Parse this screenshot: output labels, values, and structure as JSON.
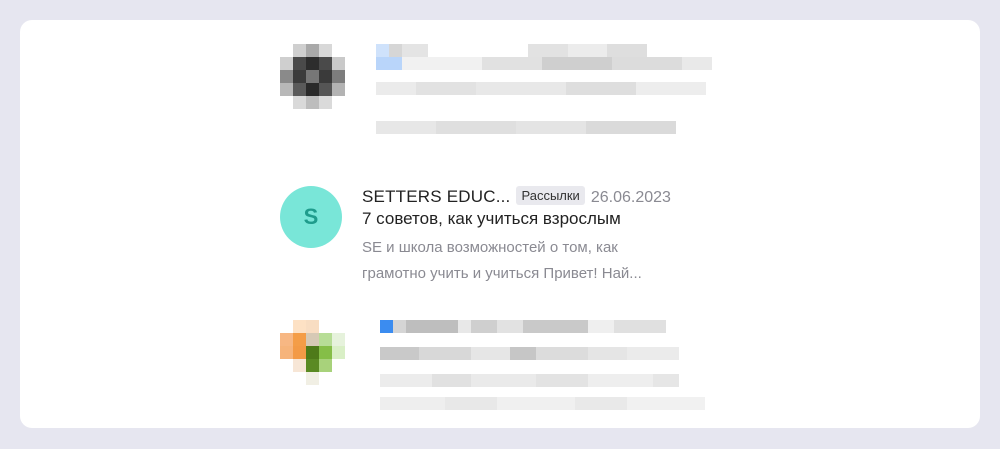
{
  "mail_list": {
    "items": [
      {
        "blurred": true
      },
      {
        "blurred": false,
        "avatar_letter": "S",
        "avatar_color": "#79e6d8",
        "sender": "SETTERS EDUC...",
        "badge": "Рассылки",
        "date": "26.06.2023",
        "subject": "7 советов, как учиться взрослым",
        "preview_line1": "SE и школа возможностей о том, как",
        "preview_line2": "грамотно учить и учиться Привет! Най..."
      },
      {
        "blurred": true
      }
    ]
  }
}
